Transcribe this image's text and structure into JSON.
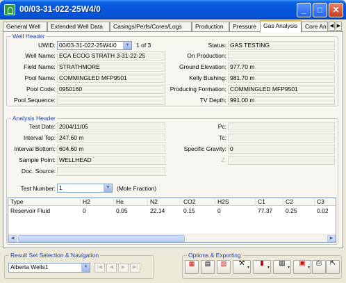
{
  "window": {
    "title": "00/03-31-022-25W4/0"
  },
  "tabs": [
    {
      "label": "General Well"
    },
    {
      "label": "Extended Well Data"
    },
    {
      "label": "Casings/Perfs/Cores/Logs"
    },
    {
      "label": "Production"
    },
    {
      "label": "Pressure"
    },
    {
      "label": "Gas Analysis",
      "active": true
    },
    {
      "label": "Core An"
    }
  ],
  "well_header": {
    "legend": "Well Header",
    "uwid_label": "UWID:",
    "uwid_value": "00/03-31-022-25W4/0",
    "count_text": "1 of 3",
    "well_name_label": "Well Name:",
    "well_name": "ECA ECOG STRATH 3-31-22-25",
    "field_name_label": "Field Name:",
    "field_name": "STRATHMORE",
    "pool_name_label": "Pool Name:",
    "pool_name": "COMMINGLED MFP9501",
    "pool_code_label": "Pool Code:",
    "pool_code": "0950160",
    "pool_sequence_label": "Pool Sequence:",
    "pool_sequence": "",
    "status_label": "Status:",
    "status": "GAS TESTING",
    "on_production_label": "On Production:",
    "on_production": "",
    "ground_elevation_label": "Ground Elevation:",
    "ground_elevation": "977.70 m",
    "kelly_bushing_label": "Kelly Bushing:",
    "kelly_bushing": "981.70 m",
    "producing_formation_label": "Producing Formation:",
    "producing_formation": "COMMINGLED MFP9501",
    "tv_depth_label": "TV Depth:",
    "tv_depth": "991.00 m"
  },
  "analysis_header": {
    "legend": "Analysis Header",
    "test_date_label": "Test Date:",
    "test_date": "2004/11/05",
    "interval_top_label": "Interval Top:",
    "interval_top": "247.60 m",
    "interval_bottom_label": "Interval Bottom:",
    "interval_bottom": "604.60 m",
    "sample_point_label": "Sample Point:",
    "sample_point": "WELLHEAD",
    "doc_source_label": "Doc. Source:",
    "doc_source": "",
    "pc_label": "Pc:",
    "pc": "",
    "tc_label": "Tc:",
    "tc": "",
    "specific_gravity_label": "Specific Gravity:",
    "specific_gravity": "0",
    "z_label": "Z:",
    "z": "",
    "test_number_label": "Test Number:",
    "test_number": "1",
    "mole_fraction_text": "(Mole Fraction)"
  },
  "table": {
    "columns": [
      "Type",
      "H2",
      "He",
      "N2",
      "CO2",
      "H2S",
      "C1",
      "C2",
      "C3"
    ],
    "rows": [
      [
        "Reservoir Fluid",
        "0",
        "0.05",
        "22.14",
        "0.15",
        "0",
        "77.37",
        "0.25",
        "0.02"
      ]
    ]
  },
  "result_nav": {
    "legend": "Result Set Selection & Navigation",
    "selected_set": "Alberta Wells1"
  },
  "options": {
    "legend": "Options & Exporting"
  }
}
